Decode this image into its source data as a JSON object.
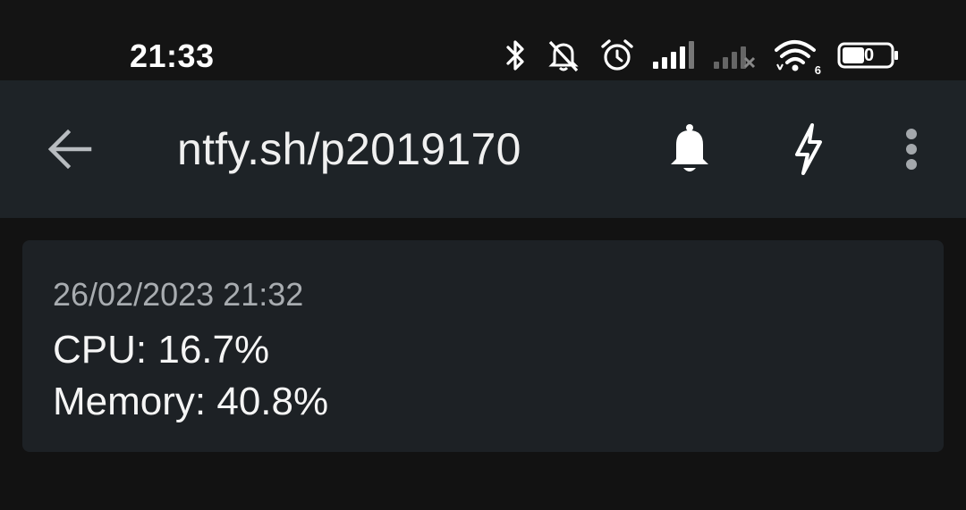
{
  "status_bar": {
    "time": "21:33",
    "icons": [
      "bluetooth-icon",
      "silent-mode-icon",
      "alarm-icon",
      "signal-strength-icon",
      "no-signal-icon",
      "wifi-icon",
      "battery-icon"
    ],
    "wifi_badge": "6",
    "battery_level": "0"
  },
  "app_bar": {
    "title": "ntfy.sh/p2019170",
    "back_icon": "arrow-left-icon",
    "actions": [
      "bell-icon",
      "lightning-icon",
      "more-vertical-icon"
    ]
  },
  "notifications": [
    {
      "time": "26/02/2023 21:32",
      "lines": [
        "CPU: 16.7%",
        "Memory: 40.8%"
      ]
    }
  ],
  "colors": {
    "background": "#121212",
    "app_bar": "#1e2327",
    "card": "#1d2125",
    "timestamp": "#a8acb0"
  }
}
